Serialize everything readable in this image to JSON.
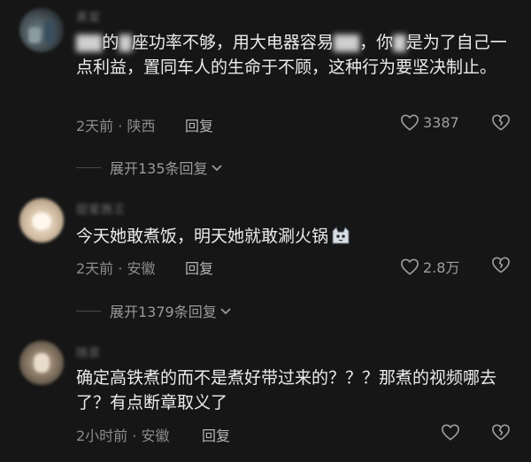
{
  "comments": [
    {
      "username": "黑棠",
      "text_parts": [
        "",
        "的",
        "座功率不够，用大电器容易",
        "，你",
        "是为了自己一点利益，置同车人的生命于不顾，这种行为要坚决制止。"
      ],
      "time": "2天前",
      "location": "陕西",
      "reply_label": "回复",
      "likes": "3387",
      "expand_label": "展开135条回复"
    },
    {
      "username": "甜蜜茜王",
      "text": "今天她敢煮饭，明天她就敢涮火锅",
      "time": "2天前",
      "location": "安徽",
      "reply_label": "回复",
      "likes": "2.8万",
      "expand_label": "展开1379条回复"
    },
    {
      "username": "随意",
      "text": "确定高铁煮的而不是煮好带过来的？？？那煮的视频哪去了？有点断章取义了",
      "time": "2小时前",
      "location": "安徽",
      "reply_label": "回复",
      "likes": ""
    }
  ],
  "meta_separator": "·",
  "icons": {
    "like": "heart-outline-icon",
    "dislike": "broken-heart-icon",
    "expand": "chevron-down-icon",
    "emoji": "cat-emoji-icon"
  },
  "colors": {
    "background": "#161616",
    "text": "#ececec",
    "meta": "#8c8c8c"
  }
}
